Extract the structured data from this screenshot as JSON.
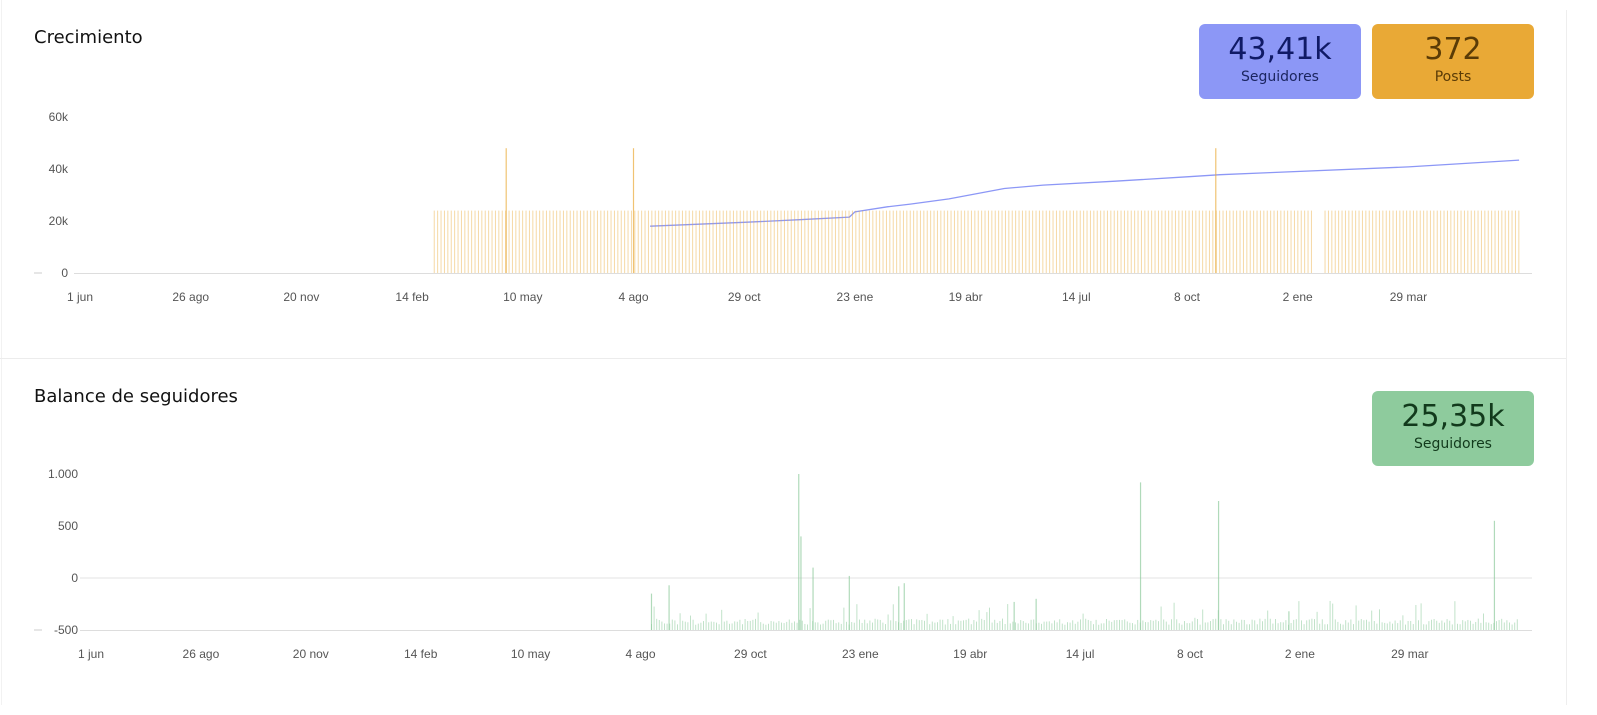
{
  "chart_data": [
    {
      "type": "line",
      "title": "Crecimiento",
      "x_ticks": [
        "1 jun",
        "26 ago",
        "20 nov",
        "14 feb",
        "10 may",
        "4 ago",
        "29 oct",
        "23 ene",
        "19 abr",
        "14 jul",
        "8 oct",
        "2 ene",
        "29 mar"
      ],
      "y_ticks": [
        "60k",
        "40k",
        "20k",
        "0"
      ],
      "ylim": [
        0,
        60000
      ],
      "grid": false,
      "series": [
        {
          "kind": "line",
          "color": "#8c97f6",
          "x": [
            5.15,
            6.0,
            6.5,
            6.95,
            7.0,
            7.3,
            7.5,
            7.85,
            8.35,
            8.7,
            9.35,
            10.0,
            10.3,
            10.75,
            12.0,
            13.0
          ],
          "values": [
            18000,
            19500,
            20500,
            21500,
            23500,
            25500,
            26500,
            28500,
            32500,
            33800,
            35300,
            37000,
            37800,
            38600,
            40800,
            43410
          ]
        },
        {
          "kind": "bars",
          "color": "#e9a936",
          "x_range": [
            3.2,
            13.0
          ],
          "typical_value": 24000,
          "spikes": [
            {
              "x": 3.85,
              "value": 48000
            },
            {
              "x": 5.0,
              "value": 48000
            },
            {
              "x": 10.26,
              "value": 48000
            }
          ],
          "gaps": [
            [
              11.15,
              11.22
            ]
          ]
        }
      ],
      "stats": [
        {
          "value": "43,41k",
          "label": "Seguidores",
          "color": "#8c97f6"
        },
        {
          "value": "372",
          "label": "Posts",
          "color": "#e9a936"
        }
      ]
    },
    {
      "type": "bar",
      "title": "Balance de seguidores",
      "x_ticks": [
        "1 jun",
        "26 ago",
        "20 nov",
        "14 feb",
        "10 may",
        "4 ago",
        "29 oct",
        "23 ene",
        "19 abr",
        "14 jul",
        "8 oct",
        "2 ene",
        "29 mar"
      ],
      "y_ticks": [
        "1.000",
        "500",
        "0",
        "-500"
      ],
      "ylim": [
        -500,
        1000
      ],
      "grid": false,
      "series": [
        {
          "kind": "bars",
          "color": "#8ecb9d",
          "baseline": -500,
          "x_range": [
            5.1,
            13.0
          ],
          "typical_value": -450,
          "spikes": [
            {
              "x": 5.1,
              "value": -150
            },
            {
              "x": 5.26,
              "value": -70
            },
            {
              "x": 6.44,
              "value": 1000
            },
            {
              "x": 6.46,
              "value": 400
            },
            {
              "x": 6.57,
              "value": 100
            },
            {
              "x": 6.9,
              "value": 20
            },
            {
              "x": 7.35,
              "value": -80
            },
            {
              "x": 7.4,
              "value": -50
            },
            {
              "x": 8.4,
              "value": -230
            },
            {
              "x": 8.6,
              "value": -200
            },
            {
              "x": 9.55,
              "value": 920
            },
            {
              "x": 10.26,
              "value": 740
            },
            {
              "x": 10.9,
              "value": -320
            },
            {
              "x": 12.77,
              "value": 550
            }
          ]
        }
      ],
      "stats": [
        {
          "value": "25,35k",
          "label": "Seguidores",
          "color": "#8ecb9d"
        }
      ]
    }
  ]
}
